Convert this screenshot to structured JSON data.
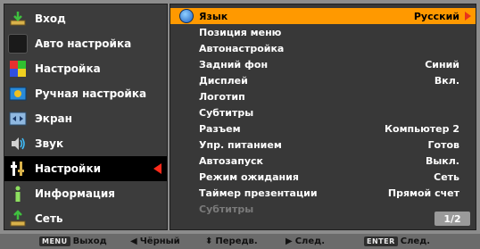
{
  "left_menu": {
    "items": [
      {
        "label": "Вход",
        "icon": "input-icon"
      },
      {
        "label": "Авто настройка",
        "icon": "auto-setup-icon"
      },
      {
        "label": "Настройка",
        "icon": "adjust-icon"
      },
      {
        "label": "Ручная настройка",
        "icon": "manual-setup-icon"
      },
      {
        "label": "Экран",
        "icon": "screen-icon"
      },
      {
        "label": "Звук",
        "icon": "sound-icon"
      },
      {
        "label": "Настройки",
        "icon": "settings-icon",
        "selected": true
      },
      {
        "label": "Информация",
        "icon": "info-icon"
      },
      {
        "label": "Сеть",
        "icon": "network-icon"
      }
    ]
  },
  "settings_panel": {
    "items": [
      {
        "label": "Язык",
        "value": "Русский",
        "highlighted": true
      },
      {
        "label": "Позиция меню",
        "value": ""
      },
      {
        "label": "Автонастройка",
        "value": ""
      },
      {
        "label": "Задний фон",
        "value": "Синий"
      },
      {
        "label": "Дисплей",
        "value": "Вкл."
      },
      {
        "label": "Логотип",
        "value": ""
      },
      {
        "label": "Субтитры",
        "value": ""
      },
      {
        "label": "Разъем",
        "value": "Компьютер 2"
      },
      {
        "label": "Упр. питанием",
        "value": "Готов"
      },
      {
        "label": "Автозапуск",
        "value": "Выкл."
      },
      {
        "label": "Режим ожидания",
        "value": "Сеть"
      },
      {
        "label": "Таймер презентации",
        "value": "Прямой счет"
      },
      {
        "label": "Субтитры",
        "value": "",
        "disabled": true
      }
    ],
    "page": "1/2"
  },
  "footer": {
    "menu_key": "MENU",
    "exit": "Выход",
    "black": "Чёрный",
    "move": "Передв.",
    "next": "След.",
    "enter_key": "ENTER",
    "enter_next": "След."
  },
  "colors": {
    "highlight": "#ff9900",
    "selected_bg": "#000000",
    "arrow": "#ff2a1a"
  }
}
